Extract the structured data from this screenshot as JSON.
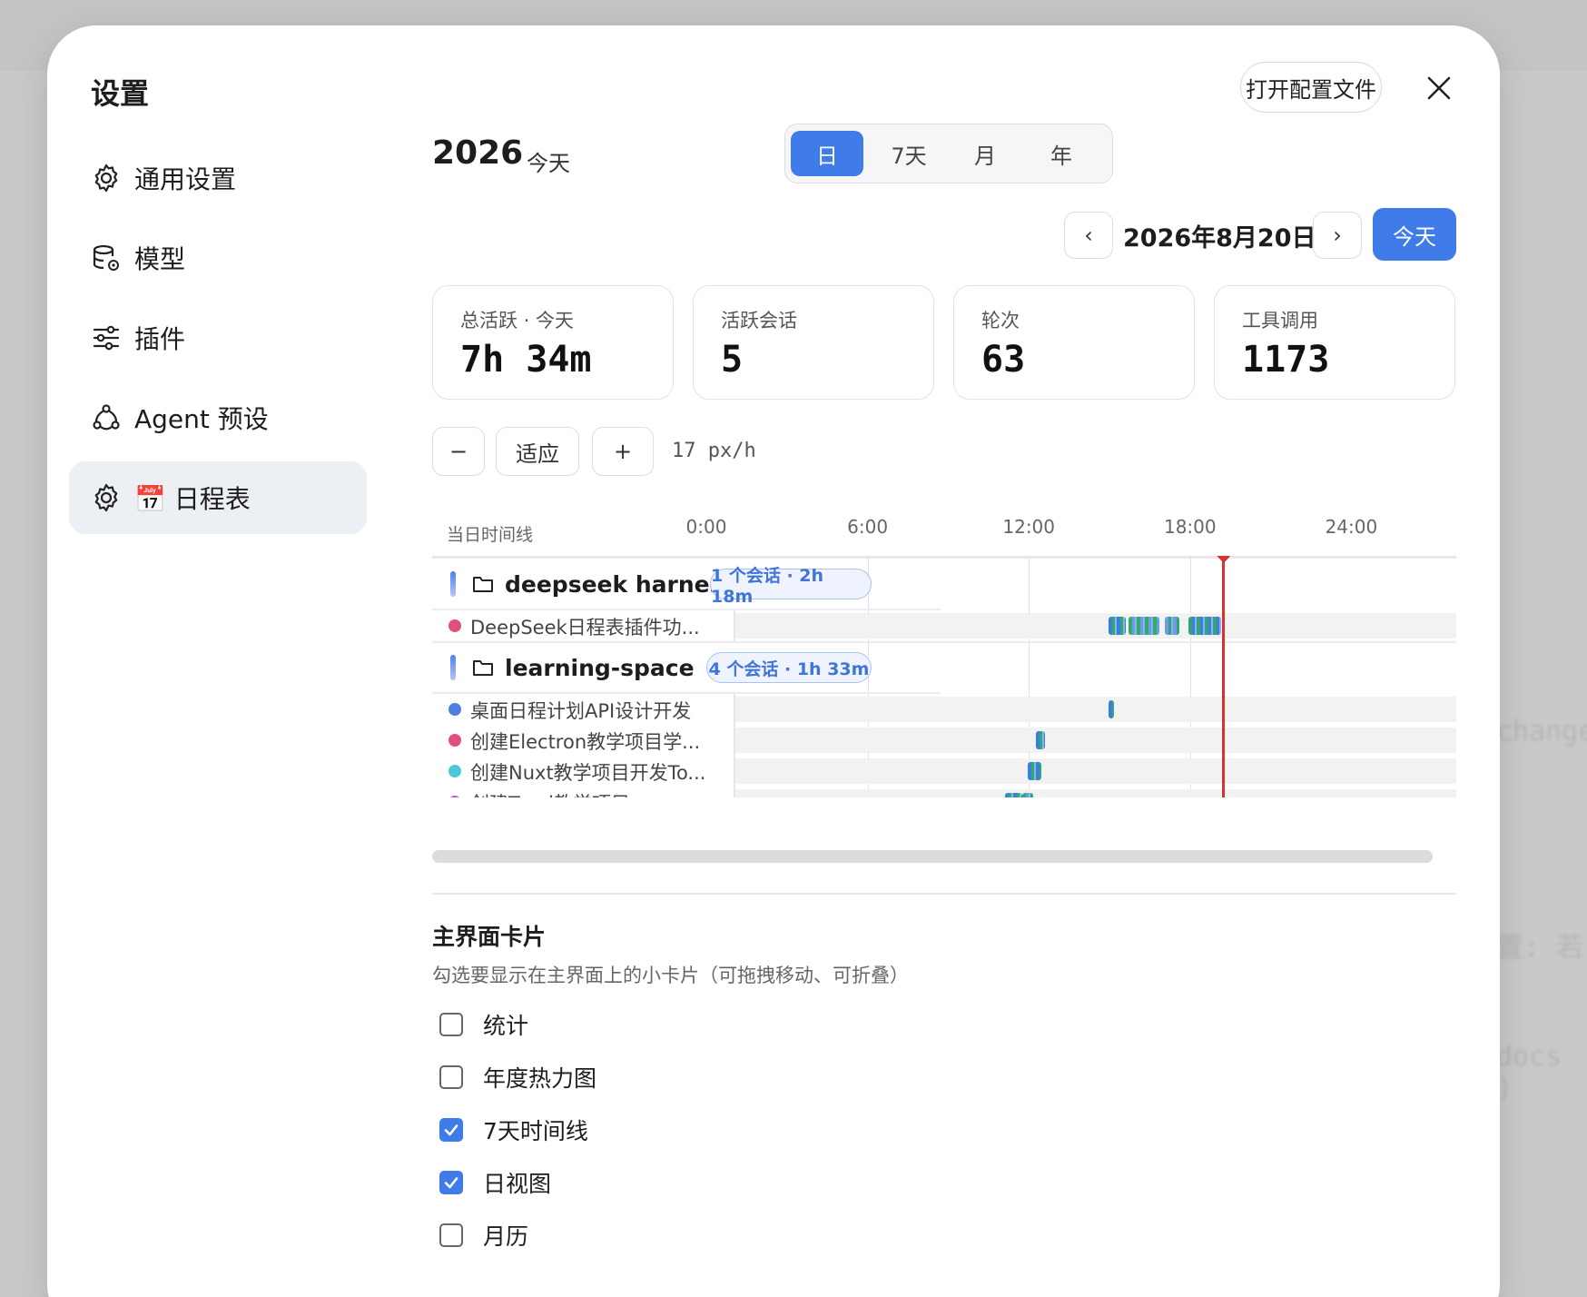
{
  "background": {
    "text_1": "change",
    "text_2": "置: 若",
    "text_3": "docs )"
  },
  "modal": {
    "title": "设置",
    "open_config_label": "打开配置文件"
  },
  "sidebar": {
    "items": [
      {
        "label": "通用设置",
        "icon": "gear-icon"
      },
      {
        "label": "模型",
        "icon": "database-gear-icon"
      },
      {
        "label": "插件",
        "icon": "sliders-icon"
      },
      {
        "label": "Agent 预设",
        "icon": "agent-network-icon"
      },
      {
        "label": "📅 日程表",
        "icon": "gear-icon",
        "active": true
      }
    ]
  },
  "header": {
    "year": "2026",
    "subtitle": "今天",
    "range_tabs": [
      {
        "label": "日",
        "active": true
      },
      {
        "label": "7天"
      },
      {
        "label": "月"
      },
      {
        "label": "年"
      }
    ],
    "prev_label": "‹",
    "next_label": "›",
    "current_date": "2026年8月20日",
    "today_label": "今天"
  },
  "stats": [
    {
      "label": "总活跃 · 今天",
      "value": "7h 34m"
    },
    {
      "label": "活跃会话",
      "value": "5"
    },
    {
      "label": "轮次",
      "value": "63"
    },
    {
      "label": "工具调用",
      "value": "1173"
    }
  ],
  "zoom": {
    "minus_label": "−",
    "fit_label": "适应",
    "plus_label": "+",
    "value": "17 px/h"
  },
  "timeline": {
    "header_label": "当日时间线",
    "ticks": [
      "0:00",
      "6:00",
      "12:00",
      "18:00",
      "24:00"
    ],
    "now_hour": 19.2,
    "colors": {
      "accent": "#3f7be9",
      "now": "#d9312b"
    },
    "groups": [
      {
        "name": "deepseek harness",
        "badge": "1 个会话 · 2h 18m",
        "sessions": [
          {
            "name": "DeepSeek日程表插件功...",
            "color": "#e0517a",
            "segments": [
              [
                14.95,
                15.6
              ],
              [
                15.7,
                16.85
              ],
              [
                17.05,
                17.6
              ],
              [
                17.95,
                19.15
              ]
            ]
          }
        ]
      },
      {
        "name": "learning-space",
        "badge": "4 个会话 · 1h 33m",
        "sessions": [
          {
            "name": "桌面日程计划API设计开发",
            "color": "#4f7fe0",
            "segments": [
              [
                14.95,
                15.1
              ]
            ]
          },
          {
            "name": "创建Electron教学项目学...",
            "color": "#e0517a",
            "segments": [
              [
                12.25,
                12.6
              ]
            ]
          },
          {
            "name": "创建Nuxt教学项目开发To...",
            "color": "#4cc9d8",
            "segments": [
              [
                11.95,
                12.45
              ]
            ]
          },
          {
            "name": "创建Tauri教学项目",
            "color": "#b25ad6",
            "segments": [
              [
                11.1,
                11.75
              ],
              [
                11.75,
                12.15
              ]
            ]
          }
        ]
      }
    ]
  },
  "cards": {
    "title": "主界面卡片",
    "description": "勾选要显示在主界面上的小卡片（可拖拽移动、可折叠）",
    "items": [
      {
        "label": "统计",
        "checked": false
      },
      {
        "label": "年度热力图",
        "checked": false
      },
      {
        "label": "7天时间线",
        "checked": true
      },
      {
        "label": "日视图",
        "checked": true
      },
      {
        "label": "月历",
        "checked": false
      }
    ]
  }
}
